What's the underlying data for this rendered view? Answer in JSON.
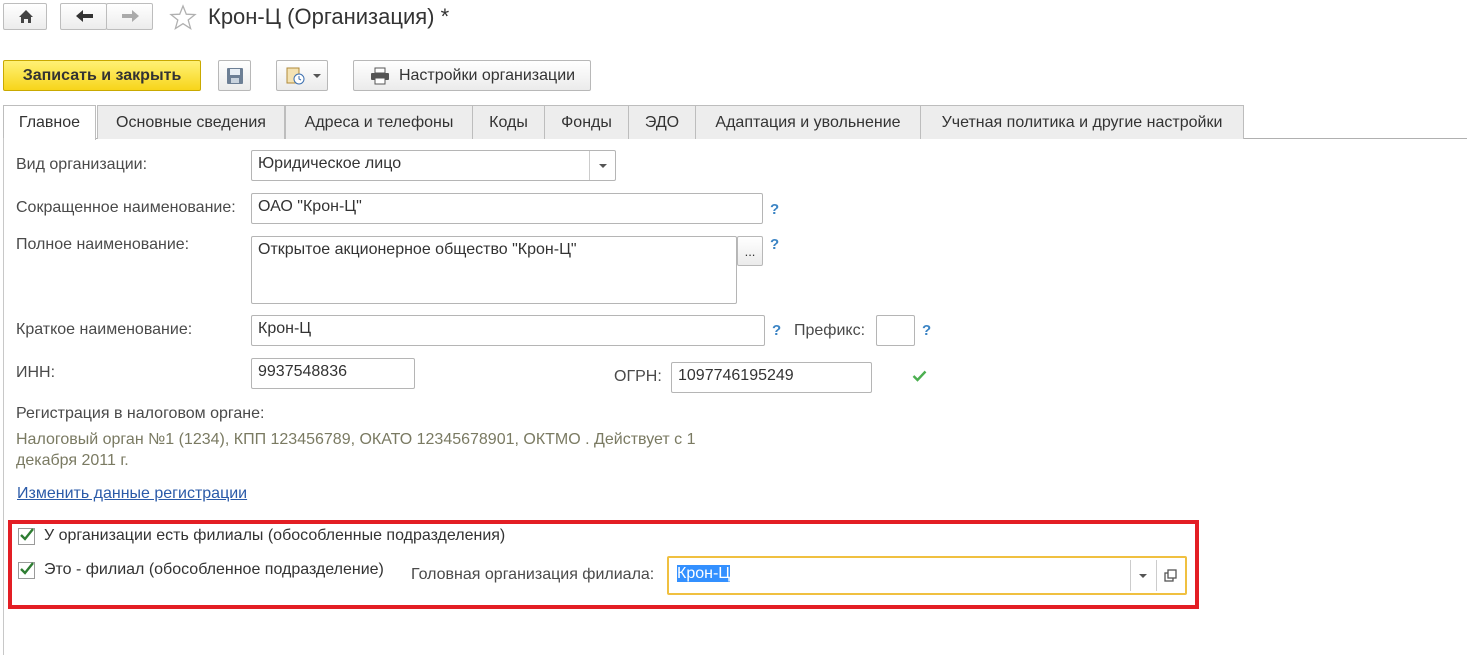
{
  "window": {
    "title": "Крон-Ц (Организация) *"
  },
  "toolbar": {
    "save_close_label": "Записать и закрыть",
    "settings_label": "Настройки организации"
  },
  "tabs": [
    {
      "label": "Главное"
    },
    {
      "label": "Основные сведения"
    },
    {
      "label": "Адреса и телефоны"
    },
    {
      "label": "Коды"
    },
    {
      "label": "Фонды"
    },
    {
      "label": "ЭДО"
    },
    {
      "label": "Адаптация и увольнение"
    },
    {
      "label": "Учетная политика и другие настройки"
    }
  ],
  "form": {
    "org_type": {
      "label": "Вид организации:",
      "value": "Юридическое лицо"
    },
    "short_name": {
      "label": "Сокращенное наименование:",
      "value": "ОАО \"Крон-Ц\""
    },
    "full_name": {
      "label": "Полное наименование:",
      "value": "Открытое акционерное общество \"Крон-Ц\"",
      "button": "..."
    },
    "brief_name": {
      "label": "Краткое наименование:",
      "value": "Крон-Ц"
    },
    "prefix": {
      "label": "Префикс:",
      "value": ""
    },
    "inn": {
      "label": "ИНН:",
      "value": "9937548836"
    },
    "ogrn": {
      "label": "ОГРН:",
      "value": "1097746195249"
    },
    "help_mark": "?",
    "registration": {
      "label": "Регистрация в налоговом органе:",
      "line1": "Налоговый орган №1 (1234), КПП 123456789, ОКАТО 12345678901, ОКТМО . Действует с 1",
      "line2": "декабря 2011 г.",
      "change_link": "Изменить данные регистрации"
    },
    "has_branches": {
      "label": "У организации есть филиалы (обособленные подразделения)",
      "checked": true
    },
    "is_branch": {
      "label": "Это - филиал (обособленное подразделение)",
      "checked": true
    },
    "head_org": {
      "label": "Головная организация филиала:",
      "value": "Крон-Ц"
    }
  },
  "colors": {
    "primary_button": "#f7d51a",
    "highlight_frame": "#e31e24",
    "focus_border": "#f0c040",
    "selection": "#3390ff",
    "link": "#2a5aa8",
    "help": "#3b84c4",
    "valid_check": "#4caf50"
  },
  "icons": [
    "home-icon",
    "back-arrow-icon",
    "forward-arrow-icon",
    "star-icon",
    "save-disk-icon",
    "document-clock-icon",
    "printer-icon",
    "checkmark-icon",
    "open-form-icon"
  ]
}
